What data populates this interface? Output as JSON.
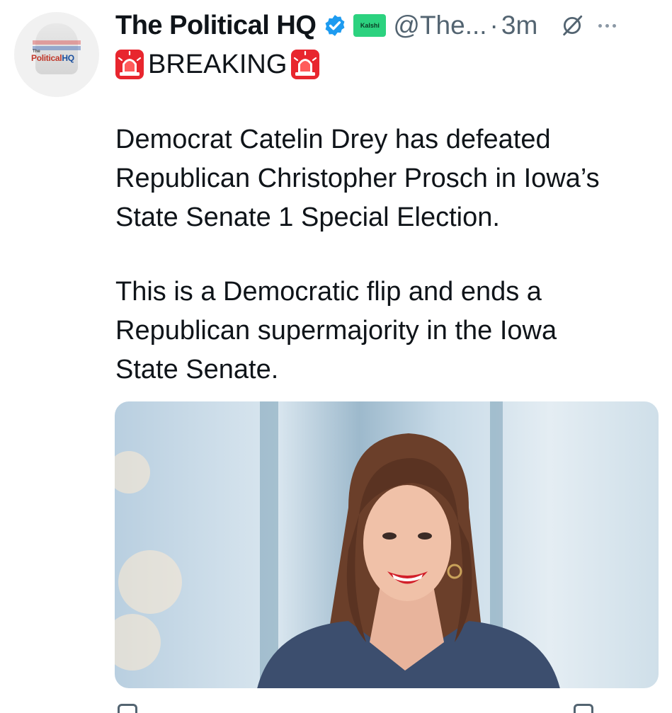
{
  "account": {
    "display_name": "The Political HQ",
    "affiliate_badge": "Kalshi",
    "handle": "@The...",
    "separator": "·",
    "timestamp": "3m",
    "avatar_small_text": "The",
    "avatar_text_part1": "Political",
    "avatar_text_part2": "HQ"
  },
  "post": {
    "headline": "BREAKING",
    "paragraph_1": "Democrat Catelin Drey has defeated\nRepublican Christopher Prosch in Iowa’s\nState Senate 1 Special Election.",
    "paragraph_2": "This is a Democratic flip and ends a\nRepublican supermajority in the Iowa\nState Senate."
  },
  "icons": {
    "verified": "verified-badge-icon",
    "siren": "police-light-emoji",
    "grok": "grok-icon",
    "more": "more-options-icon"
  },
  "colors": {
    "verified_blue": "#1d9bf0",
    "kalshi_green": "#2cd27f",
    "siren_red": "#e8262e",
    "secondary_text": "#536471"
  }
}
